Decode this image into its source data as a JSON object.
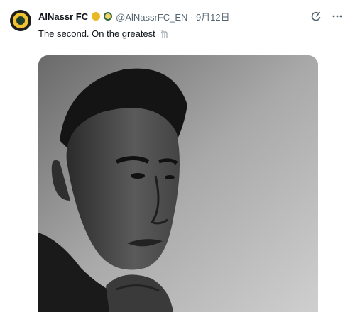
{
  "tweet": {
    "author_name": "AlNassr FC",
    "handle_and_date": "@AlNassrFC_EN · 9月12日",
    "text": "The second. On the greatest",
    "icons": {
      "verified": "verified-badge-icon",
      "affiliate": "club-badge-icon",
      "grok": "grok-icon",
      "more": "more-options-icon",
      "emoji": "goat-emoji-icon"
    },
    "colors": {
      "verified_gold": "#e8b923",
      "text_primary": "#0f1419",
      "text_secondary": "#536471"
    }
  }
}
